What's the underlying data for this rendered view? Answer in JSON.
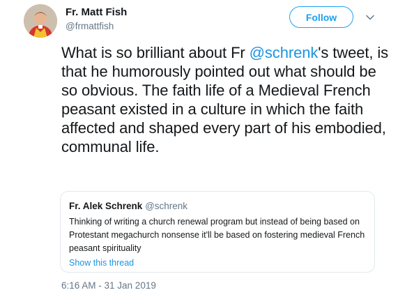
{
  "author": {
    "name": "Fr. Matt Fish",
    "handle": "@frmattfish"
  },
  "follow_label": "Follow",
  "tweet": {
    "text_before": "What is so brilliant about Fr ",
    "mention": "@schrenk",
    "text_after": "'s tweet, is that he humorously pointed out what should be so obvious. The faith life of a Medieval French peasant existed in a culture in which the faith affected and shaped every part of his embodied, communal life."
  },
  "quoted_tweet": {
    "name": "Fr. Alek Schrenk",
    "handle": "@schrenk",
    "text": "Thinking of writing a church renewal program but instead of being based on Protestant megachurch nonsense it'll be based on fostering medieval French peasant spirituality",
    "show_thread": "Show this thread"
  },
  "timestamp": "6:16 AM - 31 Jan 2019",
  "colors": {
    "accent": "#1da1f2",
    "link": "#1b95e0",
    "secondary_text": "#657786",
    "border": "#e1e8ed"
  }
}
